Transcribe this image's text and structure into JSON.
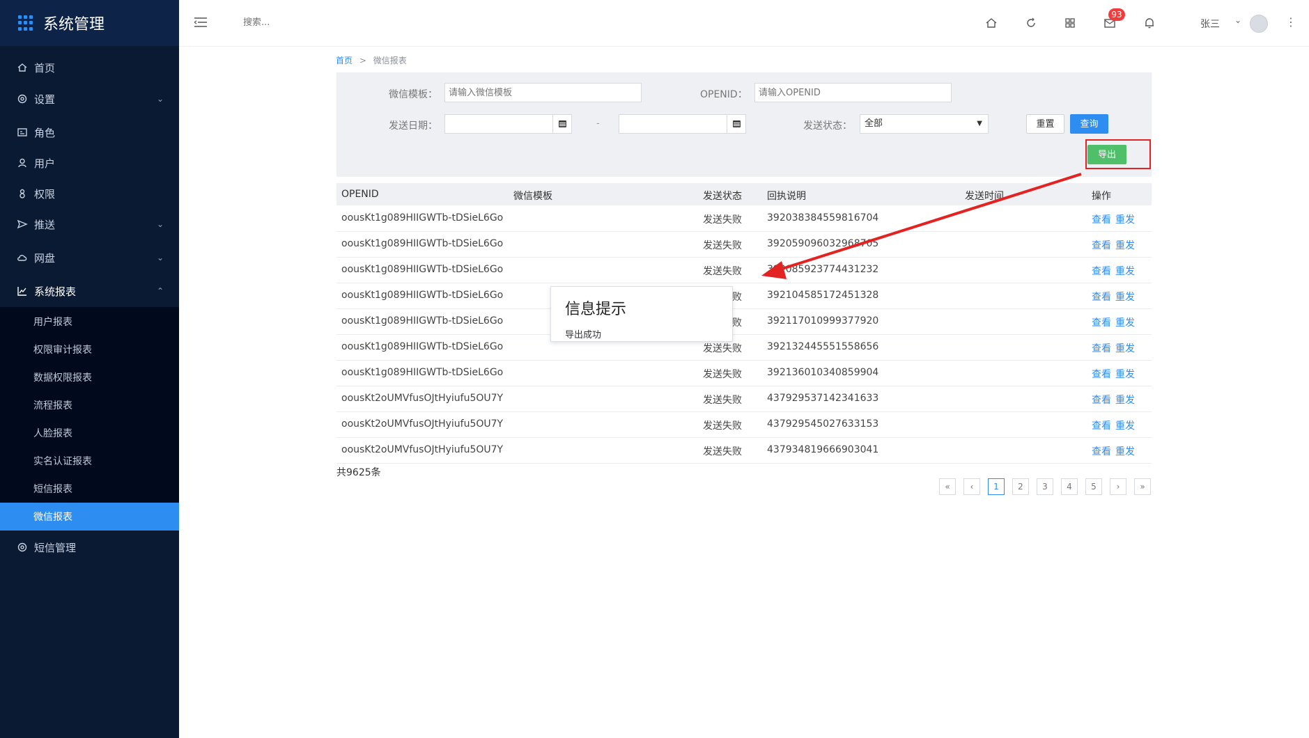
{
  "app": {
    "title": "系统管理"
  },
  "sidebar": {
    "items": [
      {
        "label": "首页",
        "icon": "home-icon"
      },
      {
        "label": "设置",
        "icon": "gear-icon",
        "chevron": "⌄"
      },
      {
        "label": "角色",
        "icon": "id-card-icon"
      },
      {
        "label": "用户",
        "icon": "user-icon"
      },
      {
        "label": "权限",
        "icon": "lock-icon"
      },
      {
        "label": "推送",
        "icon": "send-icon",
        "chevron": "⌄"
      },
      {
        "label": "网盘",
        "icon": "cloud-icon",
        "chevron": "⌄"
      },
      {
        "label": "系统报表",
        "icon": "chart-line-icon",
        "chevron": "⌃"
      },
      {
        "label": "短信管理",
        "icon": "gear-icon"
      }
    ],
    "sub_items": [
      {
        "label": "用户报表"
      },
      {
        "label": "权限审计报表"
      },
      {
        "label": "数据权限报表"
      },
      {
        "label": "流程报表"
      },
      {
        "label": "人脸报表"
      },
      {
        "label": "实名认证报表"
      },
      {
        "label": "短信报表"
      },
      {
        "label": "微信报表"
      }
    ]
  },
  "topbar": {
    "search_placeholder": "搜索...",
    "badge_count": "93",
    "user_name": "张三",
    "icons": [
      "home-icon",
      "refresh-icon",
      "grid-icon",
      "mail-icon",
      "bell-icon",
      "more-vertical-icon"
    ]
  },
  "breadcrumb": {
    "home": "首页",
    "separator": ">",
    "current": "微信报表"
  },
  "filter": {
    "template_label": "微信模板：",
    "template_placeholder": "请输入微信模板",
    "openid_label": "OPENID：",
    "openid_placeholder": "请输入OPENID",
    "date_label": "发送日期：",
    "date_separator": "-",
    "status_label": "发送状态：",
    "status_value": "全部",
    "reset_label": "重置",
    "query_label": "查询",
    "export_label": "导出"
  },
  "table": {
    "headers": [
      "OPENID",
      "微信模板",
      "发送状态",
      "回执说明",
      "发送时间",
      "操作"
    ],
    "rows": [
      {
        "openid": "oousKt1g089HIIGWTb-tDSieL6Go",
        "template": "",
        "status": "发送失败",
        "receipt": "392038384559816704",
        "time": ""
      },
      {
        "openid": "oousKt1g089HIIGWTb-tDSieL6Go",
        "template": "",
        "status": "发送失败",
        "receipt": "392059096032968705",
        "time": ""
      },
      {
        "openid": "oousKt1g089HIIGWTb-tDSieL6Go",
        "template": "",
        "status": "发送失败",
        "receipt": "392085923774431232",
        "time": ""
      },
      {
        "openid": "oousKt1g089HIIGWTb-tDSieL6Go",
        "template": "",
        "status": "发送失败",
        "receipt": "392104585172451328",
        "time": ""
      },
      {
        "openid": "oousKt1g089HIIGWTb-tDSieL6Go",
        "template": "",
        "status": "发送失败",
        "receipt": "392117010999377920",
        "time": ""
      },
      {
        "openid": "oousKt1g089HIIGWTb-tDSieL6Go",
        "template": "",
        "status": "发送失败",
        "receipt": "392132445551558656",
        "time": ""
      },
      {
        "openid": "oousKt1g089HIIGWTb-tDSieL6Go",
        "template": "",
        "status": "发送失败",
        "receipt": "392136010340859904",
        "time": ""
      },
      {
        "openid": "oousKt2oUMVfusOJtHyiufu5OU7Y",
        "template": "",
        "status": "发送失败",
        "receipt": "437929537142341633",
        "time": ""
      },
      {
        "openid": "oousKt2oUMVfusOJtHyiufu5OU7Y",
        "template": "",
        "status": "发送失败",
        "receipt": "437929545027633153",
        "time": ""
      },
      {
        "openid": "oousKt2oUMVfusOJtHyiufu5OU7Y",
        "template": "",
        "status": "发送失败",
        "receipt": "437934819666903041",
        "time": ""
      }
    ],
    "op_view": "查看",
    "op_resend": "重发"
  },
  "total_text": "共9625条",
  "pagination": {
    "first": "«",
    "prev": "‹",
    "pages": [
      "1",
      "2",
      "3",
      "4",
      "5"
    ],
    "next": "›",
    "last": "»",
    "current": "1"
  },
  "dialog": {
    "title": "信息提示",
    "message": "导出成功"
  },
  "colors": {
    "sidebar_bg": "#0b1a33",
    "accent": "#2e8df0",
    "export_green": "#4fbf69",
    "annotation_red": "#e32222",
    "badge_red": "#f23b3b"
  }
}
